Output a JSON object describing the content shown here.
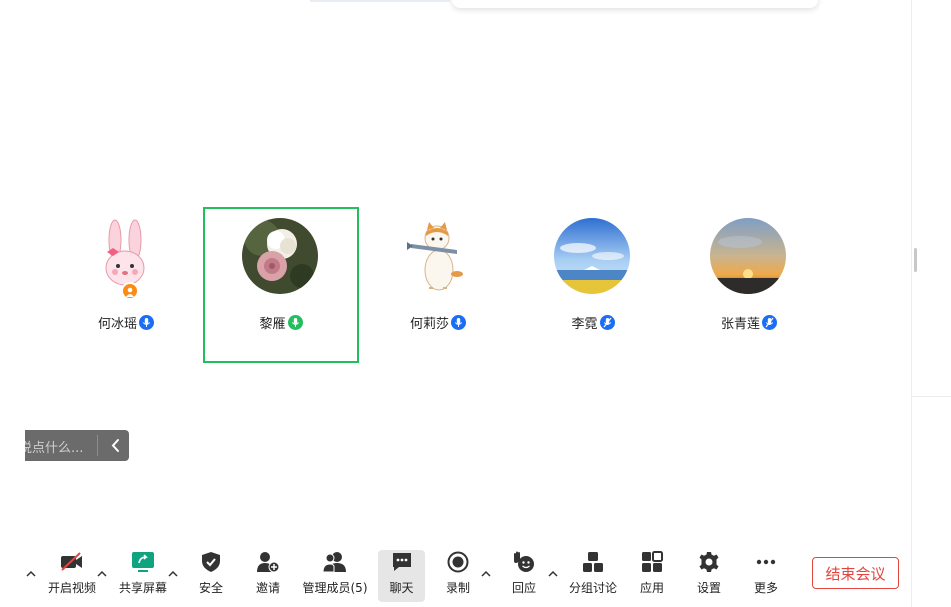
{
  "participants": [
    {
      "name": "何冰瑶",
      "avatar": "pink-bunny-avatar",
      "host": true,
      "mic_color": "#1a6ef5",
      "active": false
    },
    {
      "name": "黎雁",
      "avatar": "rose-flower-avatar",
      "host": false,
      "mic_color": "#22bf5f",
      "active": true
    },
    {
      "name": "何莉莎",
      "avatar": "cat-with-fish-avatar",
      "host": false,
      "mic_color": "#1a6ef5",
      "active": false
    },
    {
      "name": "李霓",
      "avatar": "ocean-sky-avatar",
      "host": false,
      "mic_color": "#1a6ef5",
      "active": false
    },
    {
      "name": "张青莲",
      "avatar": "sunset-avatar",
      "host": false,
      "mic_color": "#1a6ef5",
      "active": false
    }
  ],
  "chat": {
    "placeholder": "说点什么..."
  },
  "toolbar": {
    "video": "开启视频",
    "share": "共享屏幕",
    "security": "安全",
    "invite": "邀请",
    "members": "管理成员(5)",
    "chat": "聊天",
    "record": "录制",
    "reactions": "回应",
    "breakout": "分组讨论",
    "apps": "应用",
    "settings": "设置",
    "more": "更多",
    "end": "结束会议"
  },
  "colors": {
    "active_border": "#22bf5f",
    "end_button": "#e5453d",
    "share_icon": "#0fa37f",
    "mic_blue": "#1a6ef5"
  }
}
